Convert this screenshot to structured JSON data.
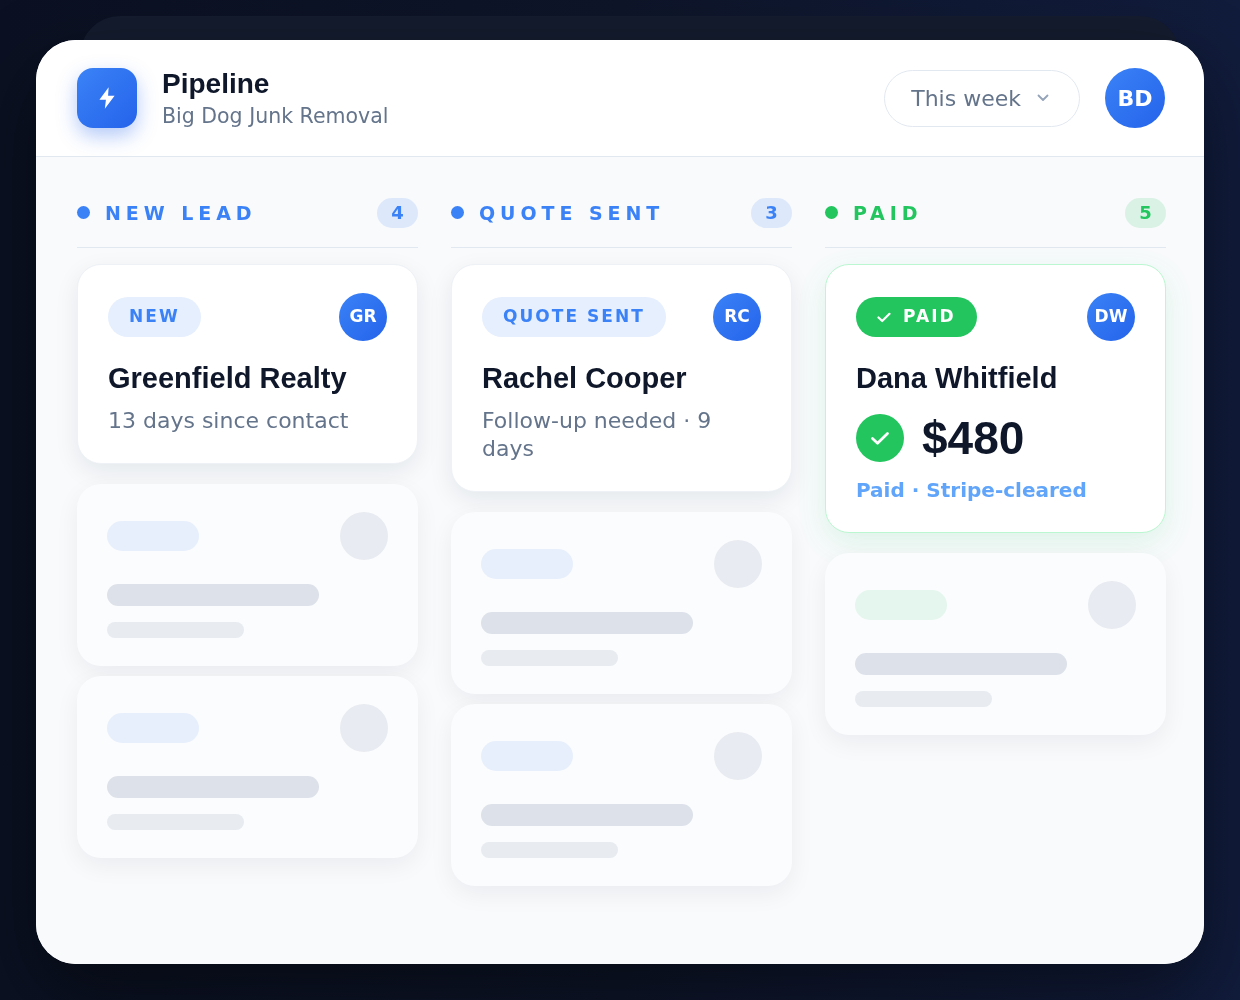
{
  "header": {
    "title": "Pipeline",
    "subtitle": "Big Dog Junk Removal",
    "period": "This week",
    "user_initials": "BD"
  },
  "columns": [
    {
      "title": "NEW LEAD",
      "count": "4",
      "color": "#3b82f6",
      "cards": [
        {
          "kind": "lead",
          "badge": "NEW",
          "initials": "GR",
          "name": "Greenfield Realty",
          "detail": "13 days since contact"
        },
        {
          "kind": "skeleton"
        },
        {
          "kind": "skeleton"
        }
      ]
    },
    {
      "title": "QUOTE SENT",
      "count": "3",
      "color": "#3b82f6",
      "cards": [
        {
          "kind": "lead",
          "badge": "QUOTE SENT",
          "initials": "RC",
          "name": "Rachel Cooper",
          "detail": "Follow-up needed · 9 days"
        },
        {
          "kind": "skeleton"
        },
        {
          "kind": "skeleton"
        }
      ]
    },
    {
      "title": "PAID",
      "count": "5",
      "color": "#22c55e",
      "cards": [
        {
          "kind": "paid",
          "badge": "PAID",
          "initials": "DW",
          "name": "Dana Whitfield",
          "amount": "$480",
          "detail": "Paid · Stripe-cleared"
        },
        {
          "kind": "skeleton"
        }
      ]
    }
  ]
}
